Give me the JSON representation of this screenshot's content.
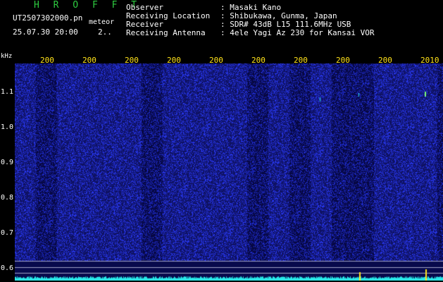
{
  "header": {
    "brand": "H R O F F T",
    "file_name": "UT2507302000.pn",
    "file_type": "meteor",
    "date_time": "25.07.30 20:00",
    "page_indicator": "2..",
    "metadata": [
      {
        "label": "Observer",
        "value": ": Masaki Kano"
      },
      {
        "label": "Receiving Location",
        "value": ": Shibukawa, Gunma, Japan"
      },
      {
        "label": "Receiver",
        "value": ": SDR# 43dB L15 111.6MHz USB"
      },
      {
        "label": "Receiving Antenna",
        "value": ": 4ele Yagi Az 230 for Kansai VOR"
      }
    ]
  },
  "spectrogram": {
    "unit": "kHz",
    "y_ticks": [
      "1.1",
      "1.0",
      "0.9",
      "0.8",
      "0.7",
      "0.6"
    ],
    "x_ticks": [
      "200",
      "200",
      "200",
      "200",
      "200",
      "200",
      "200",
      "200",
      "200",
      "2010"
    ],
    "colors": {
      "background": "#080a4c",
      "noise": "#2a34c8",
      "signal": "#29e6e6",
      "axis_text": "#ffe21a",
      "brand": "#2ecc40"
    }
  }
}
